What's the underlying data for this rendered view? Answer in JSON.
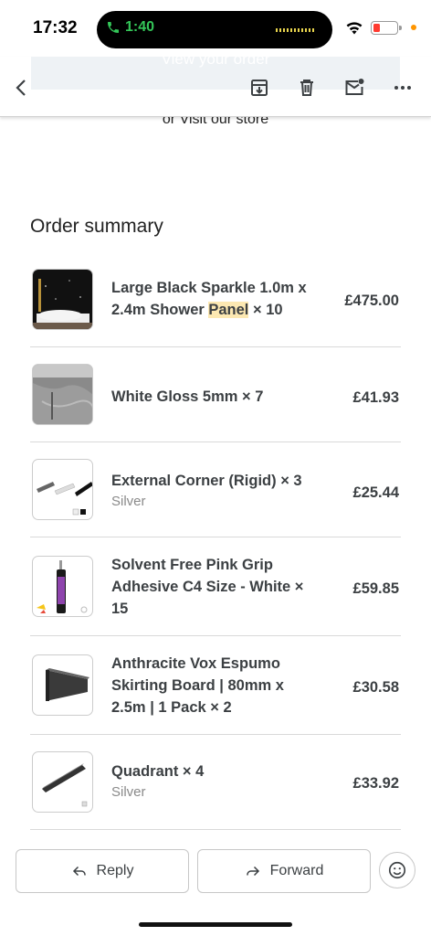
{
  "status_bar": {
    "time": "17:32",
    "call_timer": "1:40",
    "battery_color": "#ff3b30",
    "call_color": "#34c759"
  },
  "toolbar": {
    "banner_text": "View your order",
    "icons": [
      "back-icon",
      "archive-icon",
      "delete-icon",
      "mark-unread-icon",
      "more-icon"
    ]
  },
  "email": {
    "store_link": "or Visit our store",
    "order_summary_title": "Order summary",
    "items": [
      {
        "name": "Large Black Sparkle 1.0m x 2.4m Shower ",
        "highlight": "Panel",
        "name_end": " × 10",
        "variant": "",
        "price": "£475.00"
      },
      {
        "name": "White Gloss 5mm × 7",
        "variant": "",
        "price": "£41.93"
      },
      {
        "name": "External Corner (Rigid) × 3",
        "variant": "Silver",
        "price": "£25.44"
      },
      {
        "name": "Solvent Free Pink Grip Adhesive C4 Size - White × 15",
        "variant": "",
        "price": "£59.85"
      },
      {
        "name": "Anthracite Vox Espumo Skirting Board | 80mm x 2.5m | 1 Pack × 2",
        "variant": "",
        "price": "£30.58"
      },
      {
        "name": "Quadrant × 4",
        "variant": "Silver",
        "price": "£33.92"
      }
    ]
  },
  "actions": {
    "reply_label": "Reply",
    "forward_label": "Forward"
  },
  "colors": {
    "highlight": "#fce8b2",
    "text": "#3c4043"
  }
}
